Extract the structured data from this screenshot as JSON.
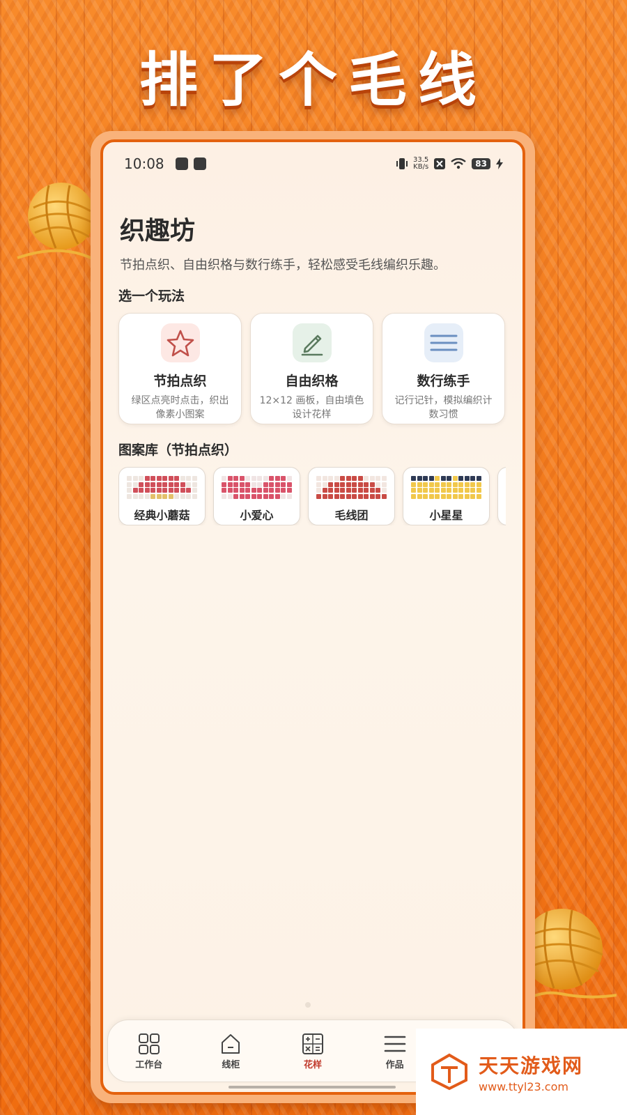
{
  "banner": {
    "title": "排了个毛线"
  },
  "status_bar": {
    "time": "10:08",
    "speed_value": "33.5",
    "speed_unit": "KB/s",
    "battery": "83",
    "icons": [
      "mail-icon",
      "app-icon",
      "vibrate-icon",
      "close-box-icon",
      "wifi-icon",
      "charging-icon"
    ]
  },
  "header": {
    "title": "织趣坊",
    "subtitle": "节拍点织、自由织格与数行练手，轻松感受毛线编织乐趣。"
  },
  "modes_section": {
    "title": "选一个玩法",
    "items": [
      {
        "name": "节拍点织",
        "desc": "绿区点亮时点击，织出像素小图案",
        "icon": "star-icon",
        "icon_bg": "#fde8e4",
        "icon_color": "#c0504a"
      },
      {
        "name": "自由织格",
        "desc": "12×12 画板，自由填色设计花样",
        "icon": "pencil-icon",
        "icon_bg": "#e6f1e8",
        "icon_color": "#5a7a5e"
      },
      {
        "name": "数行练手",
        "desc": "记行记针，模拟编织计数习惯",
        "icon": "list-icon",
        "icon_bg": "#e6eef8",
        "icon_color": "#6a8fc0"
      }
    ]
  },
  "patterns_section": {
    "title": "图案库（节拍点织）",
    "items": [
      {
        "name": "经典小蘑菇",
        "colors": [
          "#d04f5a",
          "#e3c06a",
          "#eee6e0"
        ]
      },
      {
        "name": "小爱心",
        "colors": [
          "#d9536a",
          "#f0e4e4"
        ]
      },
      {
        "name": "毛线团",
        "colors": [
          "#c94b45",
          "#f2e6e0"
        ]
      },
      {
        "name": "小星星",
        "colors": [
          "#2e3a55",
          "#f1c84b"
        ]
      }
    ]
  },
  "tabbar": {
    "items": [
      {
        "label": "工作台",
        "icon": "grid-icon",
        "active": false
      },
      {
        "label": "线柜",
        "icon": "cabinet-icon",
        "active": false
      },
      {
        "label": "花样",
        "icon": "calculator-icon",
        "active": true
      },
      {
        "label": "作品",
        "icon": "menu-icon",
        "active": false
      },
      {
        "label": "",
        "icon": "more-icon",
        "active": false
      }
    ]
  },
  "watermark": {
    "name": "天天游戏网",
    "url": "www.ttyl23.com"
  }
}
